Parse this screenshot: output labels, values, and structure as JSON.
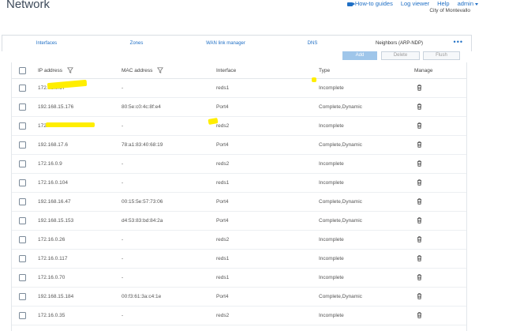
{
  "header": {
    "title": "Network",
    "links": {
      "how_to": "How-to guides",
      "log_viewer": "Log viewer",
      "help": "Help",
      "user": "admin"
    },
    "org": "City of Montevallo"
  },
  "tabs": [
    {
      "label": "Interfaces",
      "active": false
    },
    {
      "label": "Zones",
      "active": false
    },
    {
      "label": "WAN link manager",
      "active": false
    },
    {
      "label": "DNS",
      "active": false
    },
    {
      "label": "Neighbors (ARP-NDP)",
      "active": true
    }
  ],
  "toolbar": {
    "add": "Add",
    "delete": "Delete",
    "flush": "Flush"
  },
  "columns": {
    "ip": "IP address",
    "mac": "MAC address",
    "interface": "Interface",
    "type": "Type",
    "manage": "Manage"
  },
  "rows": [
    {
      "ip": "172.16.0.67",
      "mac": "-",
      "interface": "reds1",
      "type": "Incomplete"
    },
    {
      "ip": "192.168.15.176",
      "mac": "80:5e:c0:4c:8f:e4",
      "interface": "Port4",
      "type": "Complete,Dynamic"
    },
    {
      "ip": "172.16.0.69",
      "mac": "-",
      "interface": "reds2",
      "type": "Incomplete"
    },
    {
      "ip": "192.168.17.6",
      "mac": "78:a1:83:40:68:19",
      "interface": "Port4",
      "type": "Complete,Dynamic"
    },
    {
      "ip": "172.16.0.9",
      "mac": "-",
      "interface": "reds2",
      "type": "Incomplete"
    },
    {
      "ip": "172.16.0.104",
      "mac": "-",
      "interface": "reds1",
      "type": "Incomplete"
    },
    {
      "ip": "192.168.16.47",
      "mac": "00:15:5e:57:73:06",
      "interface": "Port4",
      "type": "Complete,Dynamic"
    },
    {
      "ip": "192.168.15.153",
      "mac": "d4:53:83:bd:84:2a",
      "interface": "Port4",
      "type": "Complete,Dynamic"
    },
    {
      "ip": "172.16.0.26",
      "mac": "-",
      "interface": "reds2",
      "type": "Incomplete"
    },
    {
      "ip": "172.16.0.117",
      "mac": "-",
      "interface": "reds1",
      "type": "Incomplete"
    },
    {
      "ip": "172.16.0.70",
      "mac": "-",
      "interface": "reds1",
      "type": "Incomplete"
    },
    {
      "ip": "192.168.15.184",
      "mac": "00:f3:61:3a:c4:1e",
      "interface": "Port4",
      "type": "Complete,Dynamic"
    },
    {
      "ip": "172.16.0.35",
      "mac": "-",
      "interface": "reds2",
      "type": "Incomplete"
    }
  ],
  "colors": {
    "accent": "#1f6fc5",
    "highlight": "#ffee00",
    "primary_button": "#9fc6ea"
  }
}
